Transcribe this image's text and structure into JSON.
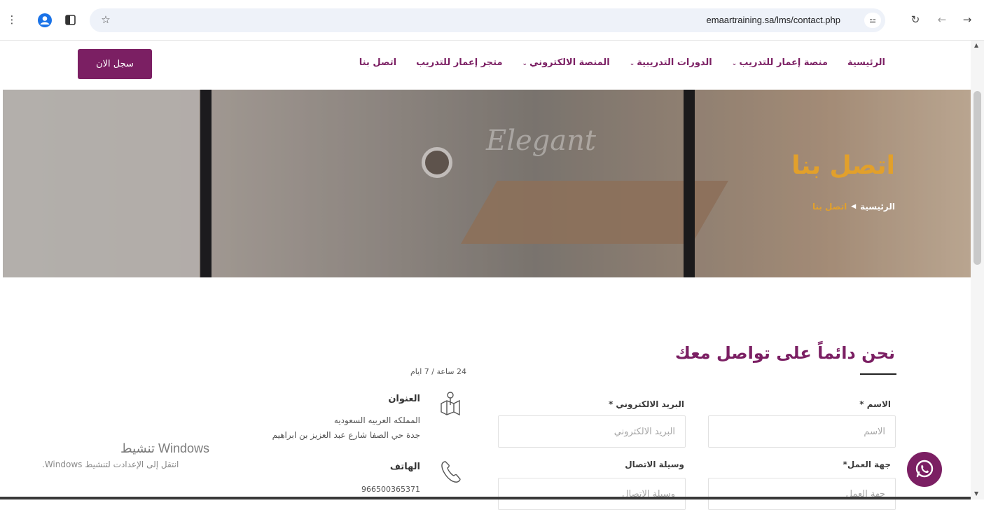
{
  "browser": {
    "url": "emaartraining.sa/lms/contact.php",
    "menu_icon": "⋮",
    "back_icon": "←",
    "forward_icon": "→",
    "reload_icon": "↻",
    "star_icon": "☆"
  },
  "header": {
    "nav_items": [
      {
        "label": "الرئيسية"
      },
      {
        "label": "منصة إعمار للتدريب"
      },
      {
        "label": "الدورات التدريبية"
      },
      {
        "label": "المنصة الالكتروني"
      },
      {
        "label": "متجر إعمار للتدريب"
      },
      {
        "label": "اتصل بنا"
      }
    ],
    "register_label": "سجل الان",
    "accent": "#7b1f63"
  },
  "banner": {
    "title": "اتصل بنا",
    "script_text": "Elegant",
    "breadcrumb": {
      "home": "الرئيسية",
      "current": "اتصل بنا"
    },
    "accent": "#e2a02b"
  },
  "contact": {
    "title": "نحن دائماً على تواصل معك",
    "fields": {
      "name_label": "الاسم *",
      "name_placeholder": "الاسم",
      "email_label": "البريد الالكتروني *",
      "email_placeholder": "البريد الالكتروني",
      "org_label": "جهة العمل*",
      "org_placeholder": "جهة العمل",
      "method_label": "وسيلة الاتصال",
      "method_placeholder": "وسيلة الاتصال"
    },
    "info": {
      "hours": "24 ساعة / 7 ايام",
      "address_title": "العنوان",
      "address_line1": "المملكه العربيه السعوديه",
      "address_line2": "جدة حي الصفا شارع عبد العزيز بن ابراهيم",
      "phone_title": "الهاتف",
      "phone": "966500365371"
    }
  },
  "windows_watermark": {
    "title": "تنشيط Windows",
    "subtitle": "انتقل إلى الإعدادت لتنشيط Windows."
  }
}
